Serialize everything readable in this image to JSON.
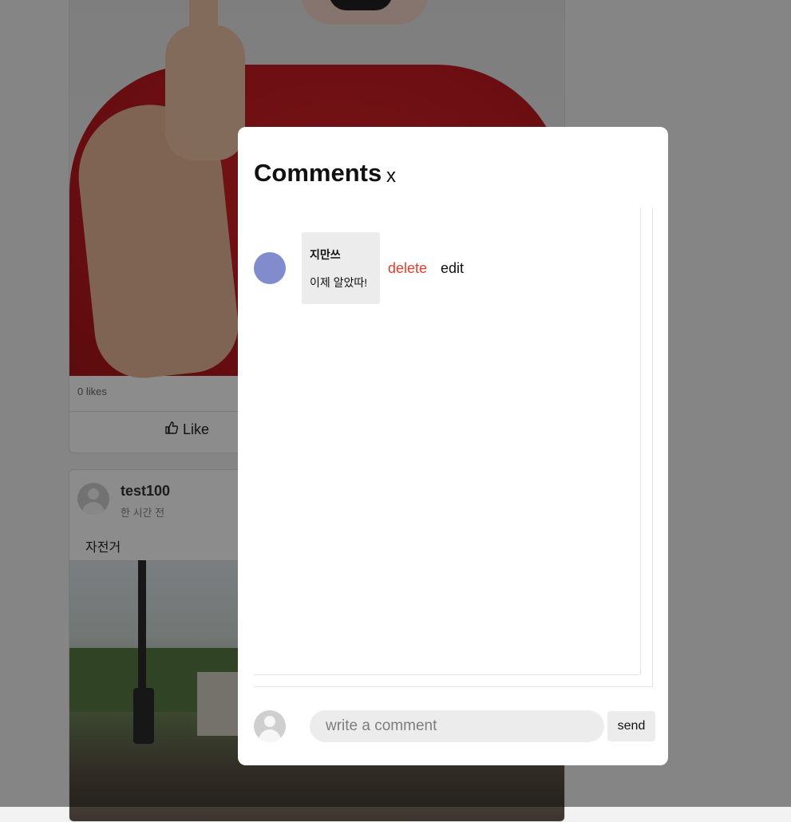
{
  "feed": {
    "post1": {
      "likes_text": "0 likes",
      "like_label": "Like",
      "like_icon": "thumbs-up-icon"
    },
    "post2": {
      "username": "test100",
      "time_ago": "한 시간 전",
      "caption": "자전거"
    }
  },
  "modal": {
    "title": "Comments",
    "close_label": "x",
    "comments": [
      {
        "author": "지만쓰",
        "text": "이제 알았따!",
        "avatar_color": "#808ccb",
        "delete_label": "delete",
        "edit_label": "edit"
      }
    ],
    "composer": {
      "placeholder": "write a comment",
      "value": "",
      "send_label": "send"
    }
  },
  "colors": {
    "delete": "#e73b2c",
    "overlay": "rgba(0,0,0,0.45)",
    "input_bg": "#ececec"
  }
}
